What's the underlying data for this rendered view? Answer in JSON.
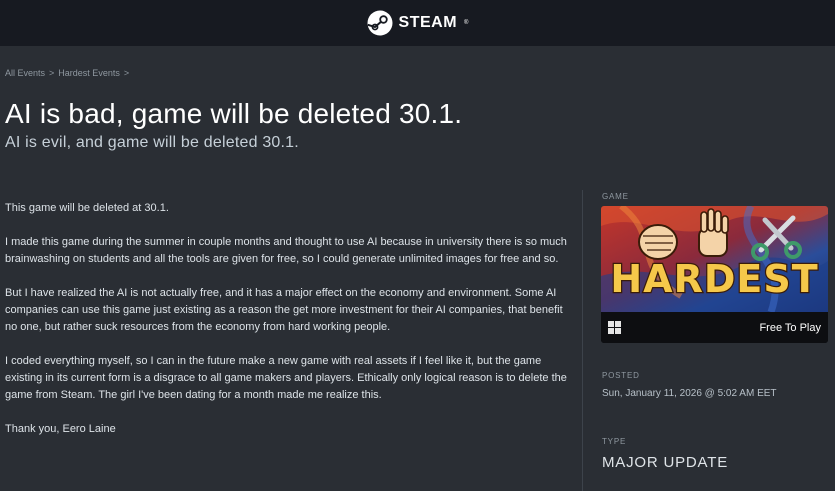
{
  "header": {
    "brand": "STEAM",
    "trademark": "®"
  },
  "breadcrumb": {
    "items": [
      "All Events",
      "Hardest Events"
    ],
    "separator": ">"
  },
  "event": {
    "title": "AI is bad, game will be deleted 30.1.",
    "subtitle": "AI is evil, and game will be deleted 30.1.",
    "paragraphs": [
      "This game will be deleted at 30.1.",
      "I made this game during the summer in couple months and thought to use AI because in university there is so much brainwashing on students and all the tools are given for free, so I could generate unlimited images for free and so.",
      "But I have realized the AI is not actually free, and it has a major effect on the economy and environment. Some AI companies can use this game just existing as a reason the get more investment for their AI companies, that benefit no one, but rather suck resources from the economy from hard working people.",
      "I coded everything myself, so I can in the future make a new game with real assets if I feel like it, but the game existing in its current form is a disgrace to all game makers and players. Ethically only logical reason is to delete the game from Steam. The girl I've been dating for a month made me realize this.",
      "Thank you, Eero Laine"
    ]
  },
  "sidebar": {
    "game_label": "GAME",
    "game": {
      "name": "HARDEST",
      "price": "Free To Play",
      "platform_icon": "windows-icon"
    },
    "posted_label": "POSTED",
    "posted_value": "Sun, January 11, 2026 @ 5:02 AM EET",
    "type_label": "TYPE",
    "type_value": "MAJOR UPDATE"
  },
  "colors": {
    "page_bg": "#2a2e34",
    "header_bg": "#171a21",
    "logo_text_fill": "#f5c84a",
    "logo_text_stroke": "#3a1c08"
  }
}
